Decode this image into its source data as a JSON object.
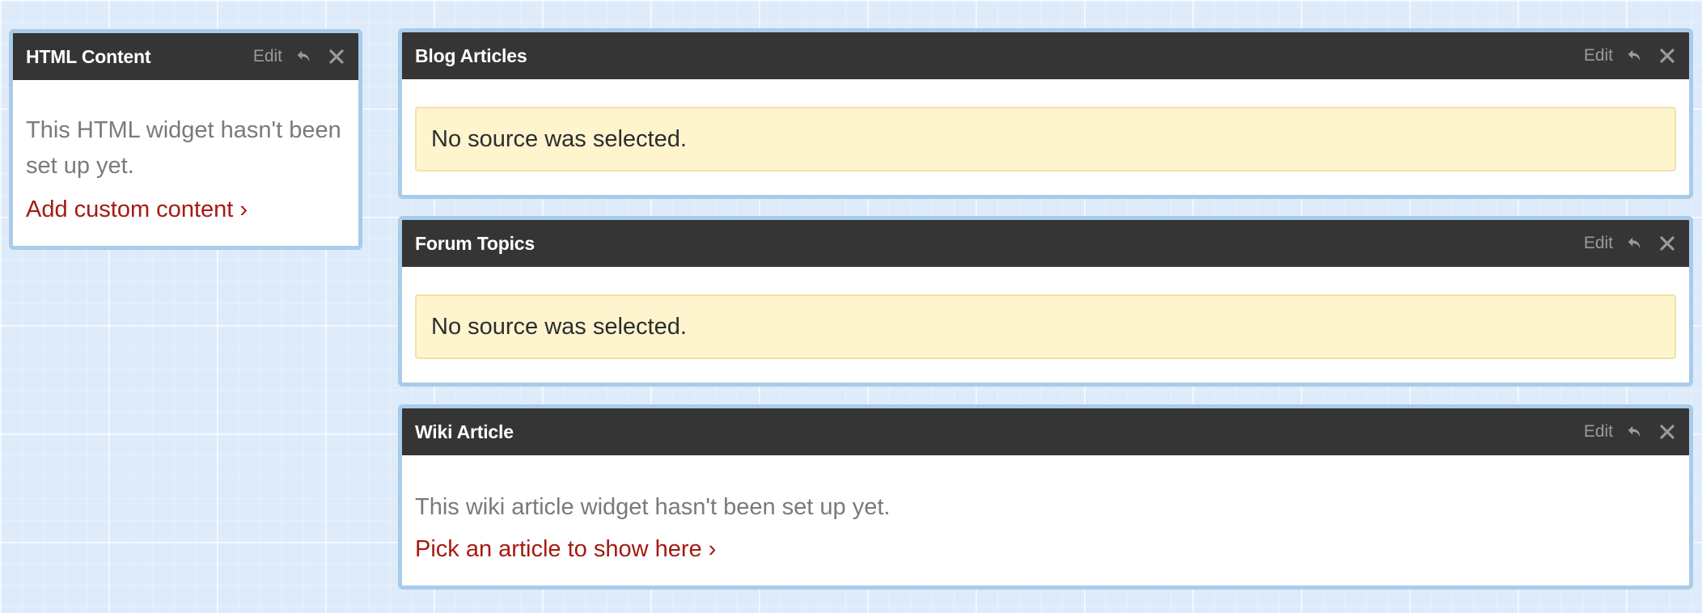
{
  "widgets": {
    "html_content": {
      "title": "HTML Content",
      "edit_label": "Edit",
      "message": "This HTML widget hasn't been set up yet.",
      "link_label": "Add custom content ›"
    },
    "blog_articles": {
      "title": "Blog Articles",
      "edit_label": "Edit",
      "alert": "No source was selected."
    },
    "forum_topics": {
      "title": "Forum Topics",
      "edit_label": "Edit",
      "alert": "No source was selected."
    },
    "wiki_article": {
      "title": "Wiki Article",
      "edit_label": "Edit",
      "message": "This wiki article widget hasn't been set up yet.",
      "link_label": "Pick an article to show here ›"
    }
  },
  "icons": {
    "undo": "undo-icon",
    "close": "close-icon"
  },
  "colors": {
    "header_bg": "#353535",
    "widget_border": "#a9cbea",
    "link": "#a51a12",
    "alert_bg": "#fef5cf",
    "canvas_bg": "#deebfa"
  }
}
